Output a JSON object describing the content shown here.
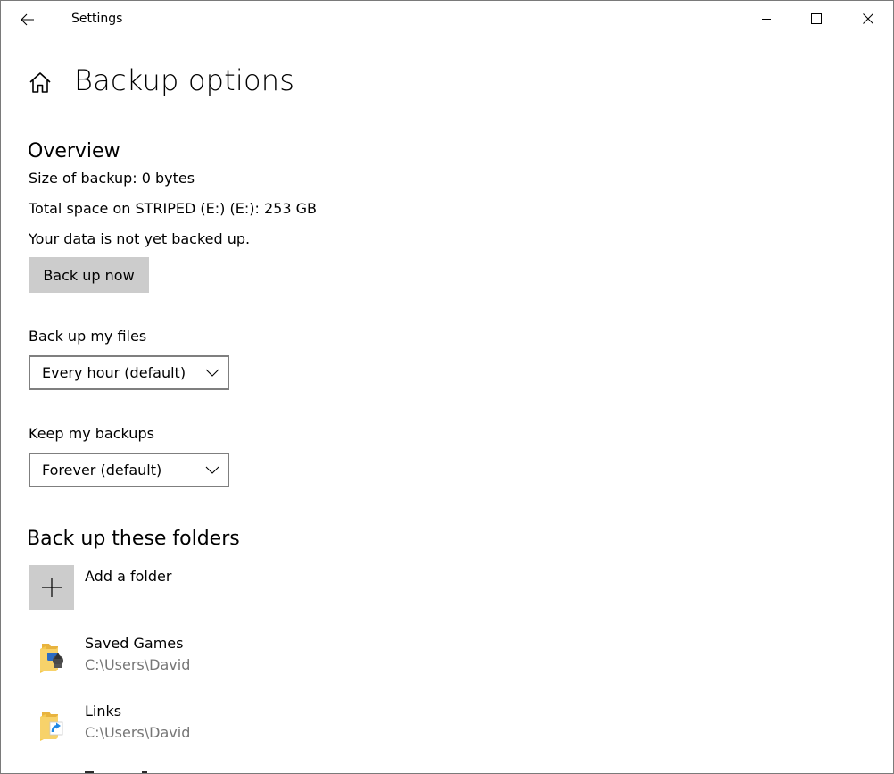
{
  "window": {
    "app_title": "Settings"
  },
  "page": {
    "title": "Backup options"
  },
  "overview": {
    "heading": "Overview",
    "size_line": "Size of backup: 0 bytes",
    "space_line": "Total space on STRIPED (E:) (E:): 253 GB",
    "status_line": "Your data is not yet backed up.",
    "backup_now_label": "Back up now"
  },
  "frequency": {
    "label": "Back up my files",
    "selected": "Every hour (default)"
  },
  "retention": {
    "label": "Keep my backups",
    "selected": "Forever (default)"
  },
  "folders": {
    "heading": "Back up these folders",
    "add_label": "Add a folder",
    "items": [
      {
        "name": "Saved Games",
        "path": "C:\\Users\\David",
        "icon": "saved-games-folder-icon"
      },
      {
        "name": "Links",
        "path": "C:\\Users\\David",
        "icon": "links-folder-icon"
      }
    ]
  },
  "colors": {
    "button_bg": "#cccccc",
    "secondary_text": "#767676",
    "folder_yellow": "#f5c94d",
    "link_blue": "#1e88e5"
  }
}
